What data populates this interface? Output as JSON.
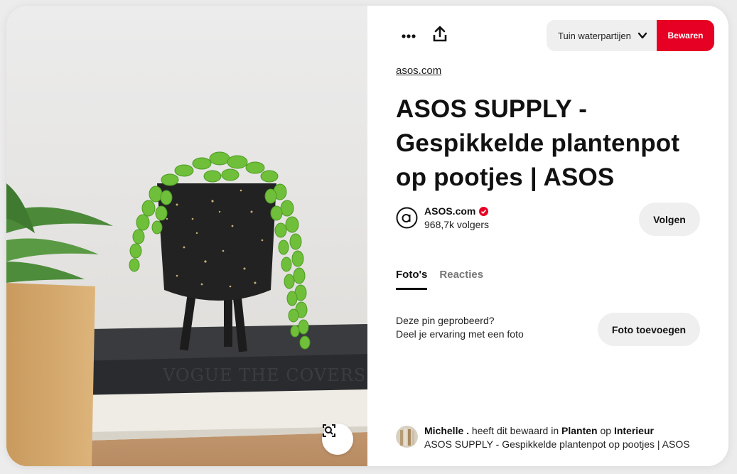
{
  "toolbar": {
    "more_icon": "ellipsis-icon",
    "share_icon": "share-upload-icon",
    "board_name": "Tuin waterpartijen",
    "save_label": "Bewaren",
    "save_color": "#e60023"
  },
  "pin": {
    "source": "asos.com",
    "title": "ASOS SUPPLY - Gespikkelde plantenpot op pootjes | ASOS",
    "image_search_icon": "visual-search-icon"
  },
  "creator": {
    "name": "ASOS.com",
    "followers": "968,7k volgers",
    "follow_label": "Volgen",
    "verified_color": "#e60023"
  },
  "tabs": [
    {
      "label": "Foto's",
      "active": true
    },
    {
      "label": "Reacties",
      "active": false
    }
  ],
  "tried": {
    "line1": "Deze pin geprobeerd?",
    "line2": "Deel je ervaring met een foto",
    "button_label": "Foto toevoegen"
  },
  "activity": {
    "user": "Michelle .",
    "text1": "heeft dit bewaard in",
    "board": "Planten",
    "text2": "op",
    "section": "Interieur",
    "pin_title": "ASOS SUPPLY - Gespikkelde plantenpot op pootjes | ASOS"
  }
}
